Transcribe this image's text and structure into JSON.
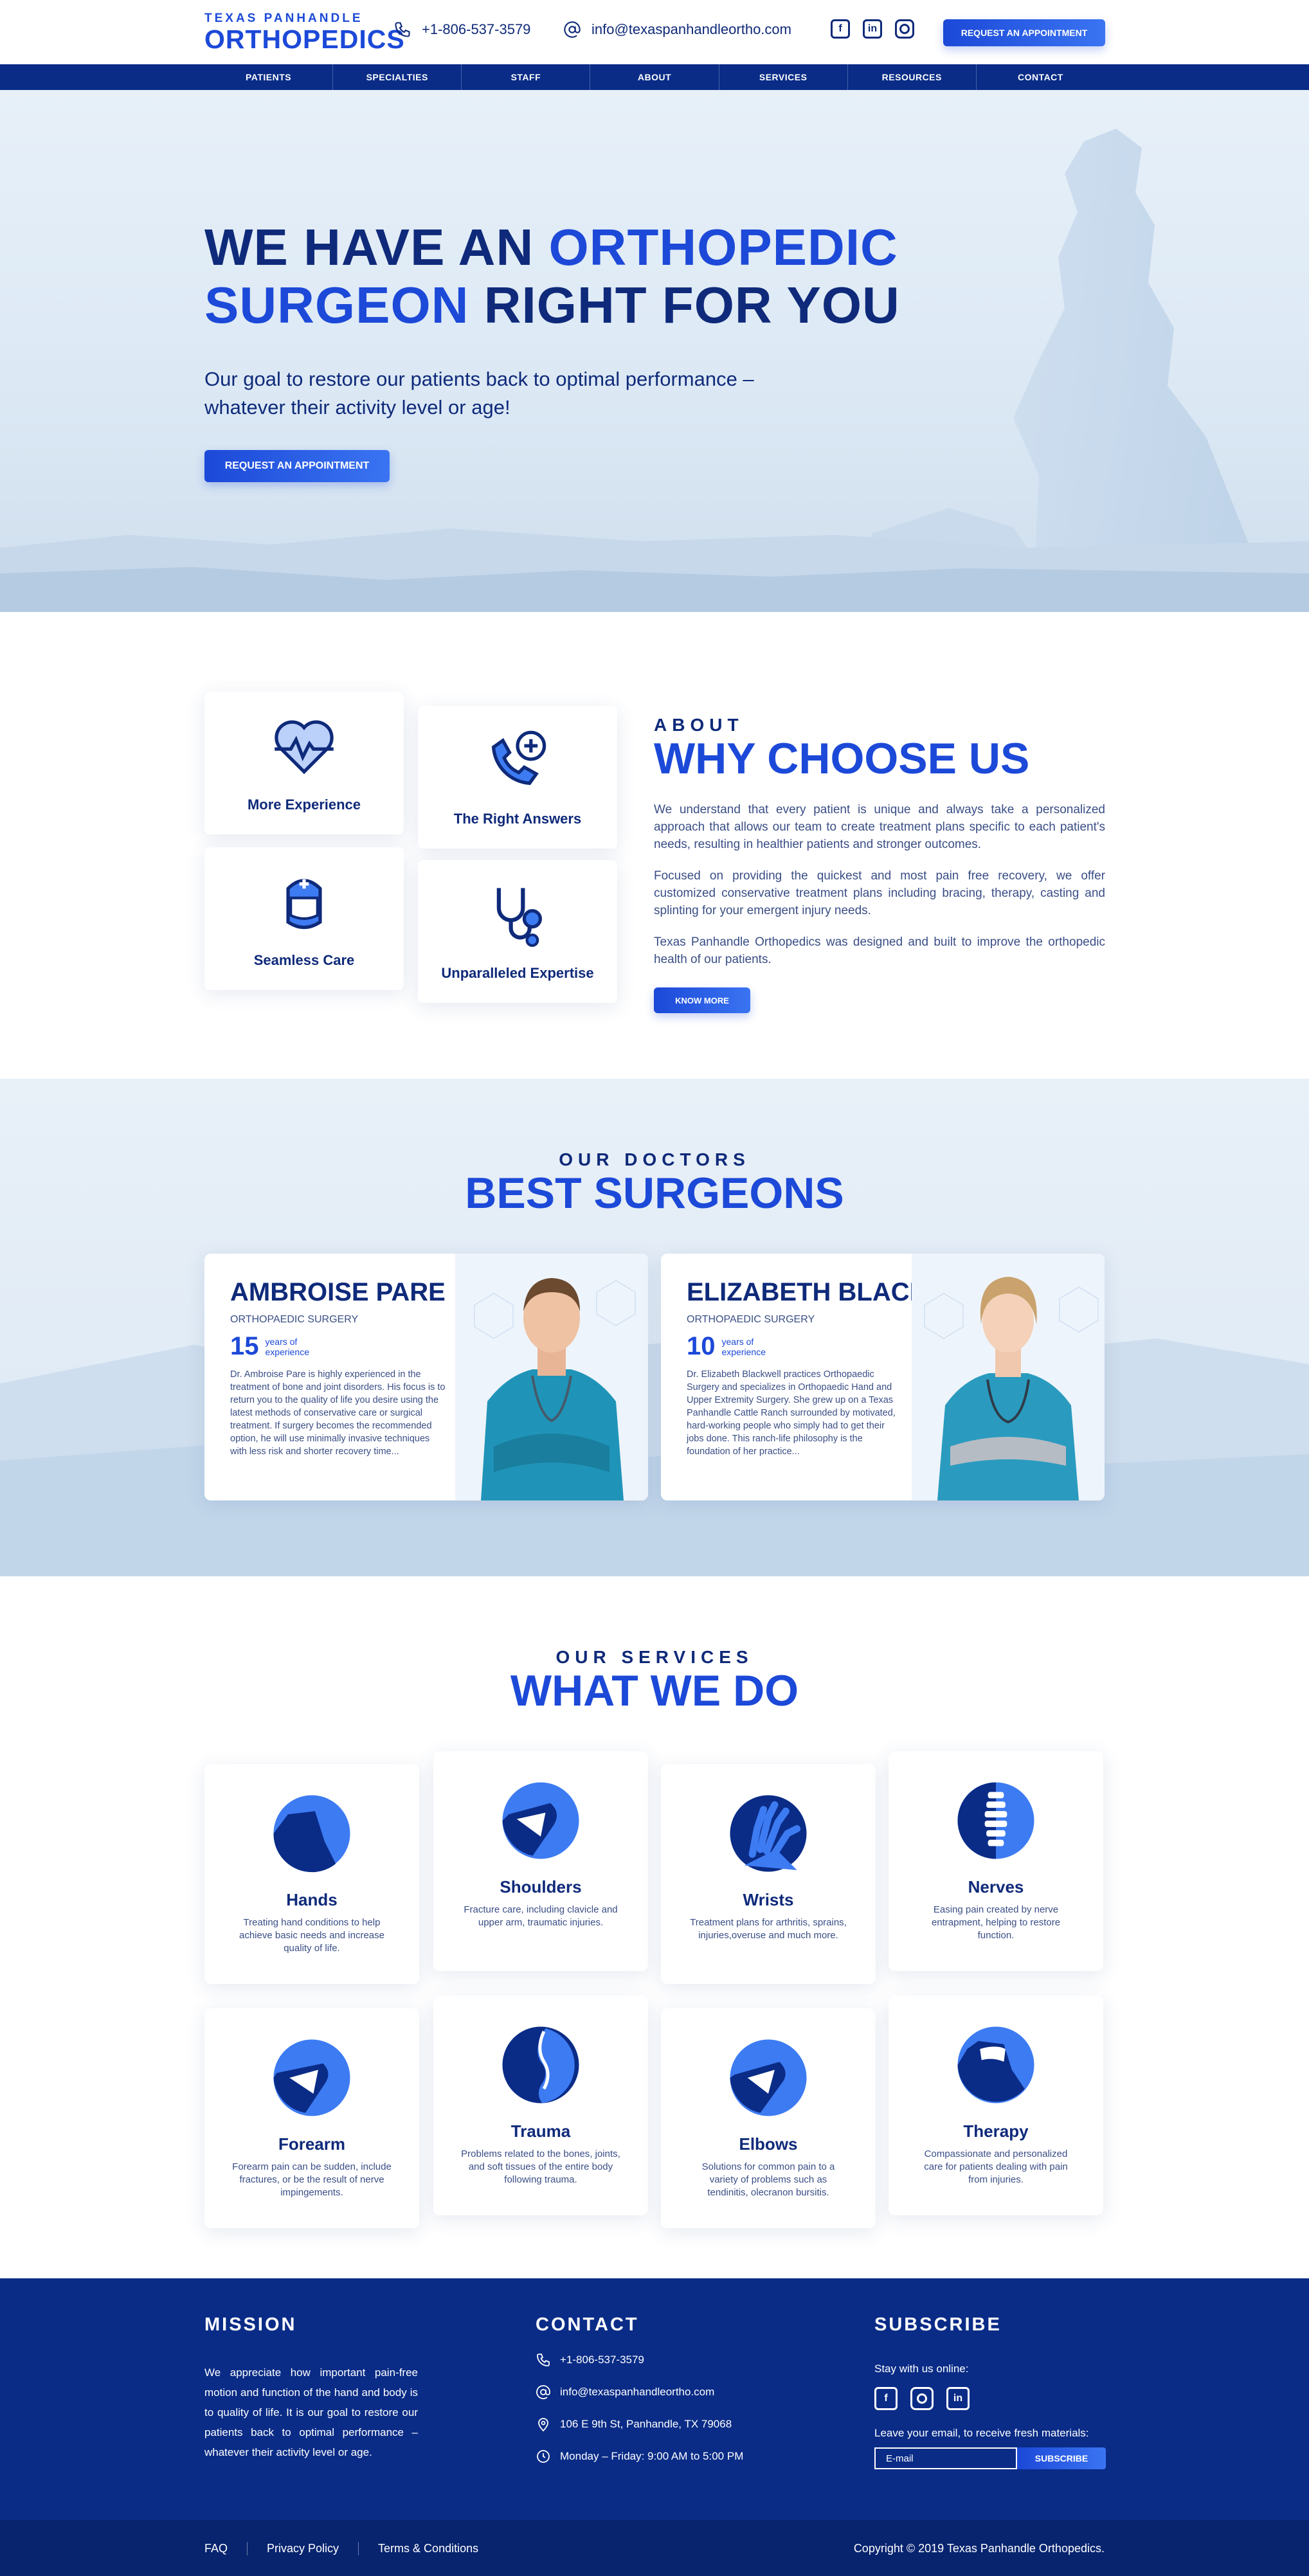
{
  "header": {
    "logo_top": "TEXAS PANHANDLE",
    "logo_main": "ORTHOPEDICS",
    "phone": "+1-806-537-3579",
    "email": "info@texaspanhandleortho.com",
    "cta": "REQUEST AN APPOINTMENT",
    "socials": [
      "facebook-icon",
      "linkedin-icon",
      "instagram-icon"
    ]
  },
  "nav": [
    "PATIENTS",
    "SPECIALTIES",
    "STAFF",
    "ABOUT",
    "SERVICES",
    "RESOURCES",
    "CONTACT"
  ],
  "hero": {
    "title_1": "WE HAVE AN ",
    "title_accent_1": "ORTHOPEDIC",
    "title_accent_2": "SURGEON",
    "title_2": " RIGHT FOR YOU",
    "subtitle": "Our goal to restore our patients back to optimal performance – whatever their activity level or age!",
    "cta": "REQUEST AN APPOINTMENT"
  },
  "about": {
    "kicker": "ABOUT",
    "heading": "WHY CHOOSE US",
    "features": [
      "More Experience",
      "The Right Answers",
      "Seamless Care",
      "Unparalleled Expertise"
    ],
    "paragraphs": [
      "We understand that every patient is unique and always take a personalized approach that allows our team to create treatment plans specific to each patient's needs, resulting in healthier patients and stronger outcomes.",
      "Focused on providing the quickest and most pain free recovery, we offer customized conservative treatment plans including bracing, therapy, casting and splinting for your emergent injury needs.",
      "Texas Panhandle Orthopedics was designed and built to improve the orthopedic health of our patients."
    ],
    "button": "KNOW MORE"
  },
  "doctors": {
    "kicker": "OUR DOCTORS",
    "heading": "BEST SURGEONS",
    "list": [
      {
        "name": "AMBROISE PARE",
        "specialty": "ORTHOPAEDIC SURGERY",
        "years": "15",
        "years_label": "years of experience",
        "bio": "Dr. Ambroise Pare is highly experienced in the treatment of bone and joint disorders. His focus is to return you to the quality of life you desire using the latest methods of conservative care or surgical treatment. If surgery becomes the recommended option, he will use minimally invasive techniques with less risk and shorter recovery time..."
      },
      {
        "name": "ELIZABETH BLACKWELL",
        "specialty": "ORTHOPAEDIC SURGERY",
        "years": "10",
        "years_label": "years of experience",
        "bio": "Dr. Elizabeth Blackwell practices Orthopaedic Surgery and specializes in Orthopaedic Hand and Upper Extremity Surgery. She grew up on a Texas Panhandle Cattle Ranch surrounded by motivated, hard-working people who simply had to get their jobs done. This ranch-life philosophy is the foundation of her practice..."
      }
    ]
  },
  "services": {
    "kicker": "OUR SERVICES",
    "heading": "WHAT WE DO",
    "items": [
      {
        "title": "Hands",
        "desc": "Treating hand conditions to help achieve basic needs and increase quality of life."
      },
      {
        "title": "Shoulders",
        "desc": "Fracture care, including clavicle and upper arm, traumatic injuries."
      },
      {
        "title": "Wrists",
        "desc": "Treatment plans for arthritis, sprains, injuries,overuse and much more."
      },
      {
        "title": "Nerves",
        "desc": "Easing pain created by nerve entrapment, helping to restore function."
      },
      {
        "title": "Forearm",
        "desc": "Forearm pain can be sudden, include fractures, or be the result of nerve impingements."
      },
      {
        "title": "Trauma",
        "desc": "Problems related to the bones, joints, and soft tissues of the entire body following trauma."
      },
      {
        "title": "Elbows",
        "desc": "Solutions for common pain to a variety of problems such as tendinitis, olecranon bursitis."
      },
      {
        "title": "Therapy",
        "desc": "Compassionate and personalized care for patients dealing with pain from injuries."
      }
    ]
  },
  "footer": {
    "mission_title": "MISSION",
    "mission_text": "We appreciate how important pain-free motion and function of the hand and body is to quality of life. It is our goal to restore our patients back to optimal performance – whatever their activity level or age.",
    "contact_title": "CONTACT",
    "phone": "+1-806-537-3579",
    "email": "info@texaspanhandleortho.com",
    "address": "106 E 9th St, Panhandle, TX 79068",
    "hours": "Monday – Friday: 9:00 AM to 5:00 PM",
    "subscribe_title": "SUBSCRIBE",
    "stay": "Stay with us online:",
    "leave": "Leave your email, to receive fresh materials:",
    "email_placeholder": "E-mail",
    "subscribe_btn": "SUBSCRIBE",
    "links": [
      "FAQ",
      "Privacy Policy",
      "Terms & Conditions"
    ],
    "copyright": "Copyright © 2019 Texas Panhandle Orthopedics."
  },
  "colors": {
    "brand": "#1c49d8",
    "navy": "#0a2c87",
    "text": "#0f2a7a"
  }
}
